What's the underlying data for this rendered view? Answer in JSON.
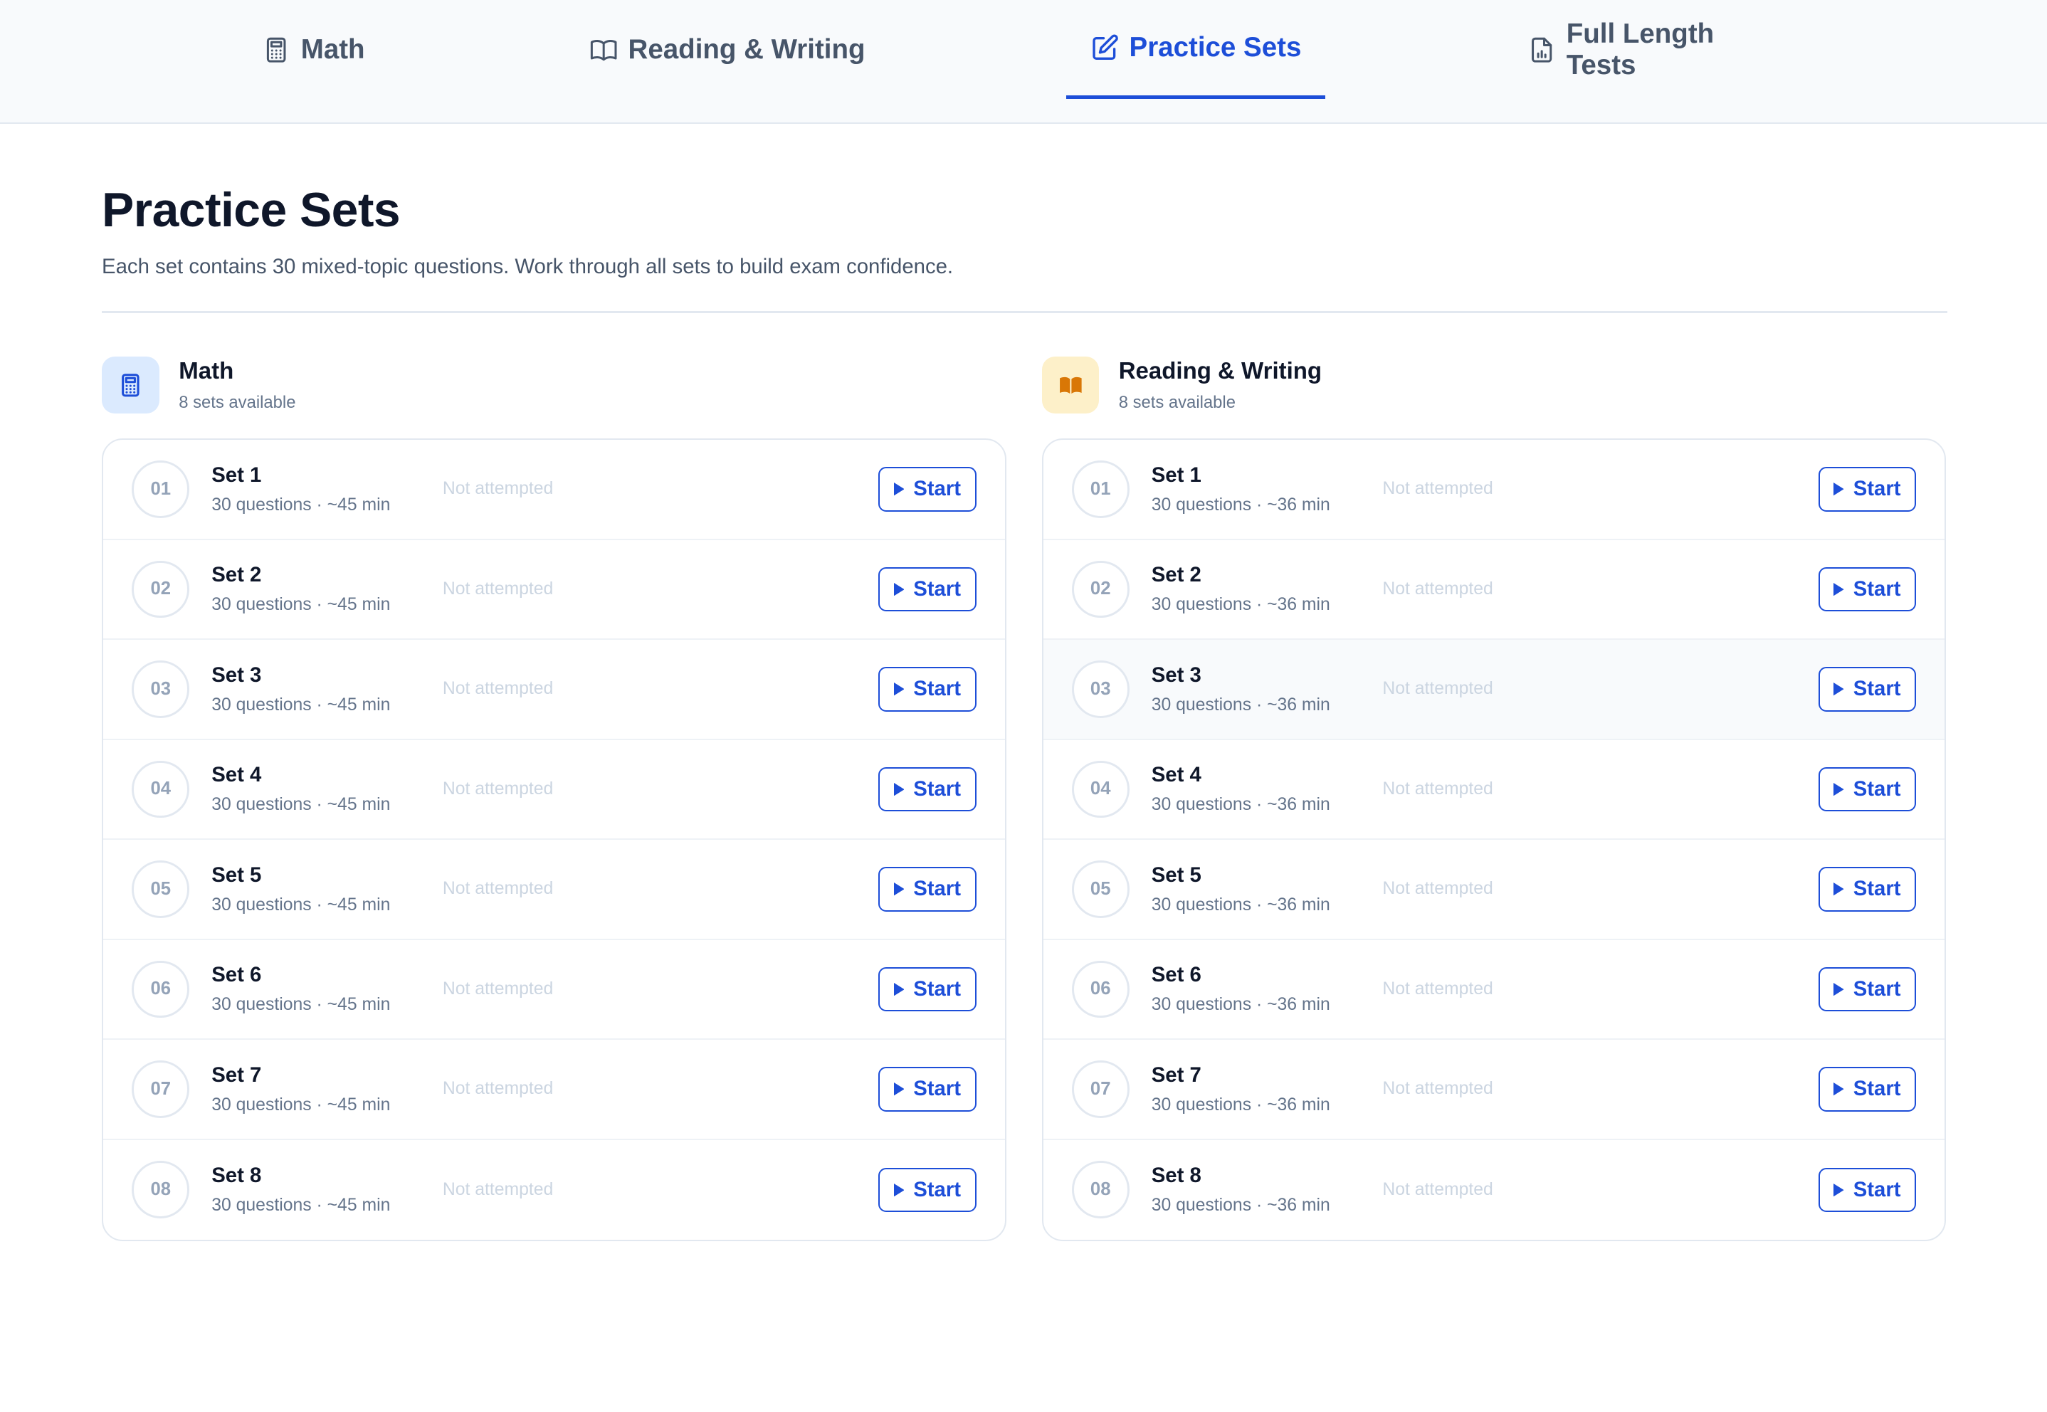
{
  "nav": {
    "tabs": [
      {
        "label": "Math",
        "icon": "calculator-icon"
      },
      {
        "label": "Reading & Writing",
        "icon": "book-open-icon"
      },
      {
        "label": "Practice Sets",
        "icon": "pencil-square-icon",
        "active": true
      },
      {
        "label": "Full Length Tests",
        "icon": "document-chart-icon"
      }
    ]
  },
  "page": {
    "title": "Practice Sets",
    "subtitle": "Each set contains 30 mixed-topic questions. Work through all sets to build exam confidence."
  },
  "colors": {
    "accent": "#1d4ed8",
    "math_icon_bg": "#dbeafe",
    "rw_icon_bg": "#fdf0c9",
    "rw_icon_fg": "#d97706"
  },
  "sections": [
    {
      "title": "Math",
      "count": "8 sets available",
      "icon": "calculator-icon",
      "sets": [
        {
          "num": "01",
          "name": "Set 1",
          "meta": "30 questions · ~45 min",
          "status": "Not attempted",
          "button": "Start"
        },
        {
          "num": "02",
          "name": "Set 2",
          "meta": "30 questions · ~45 min",
          "status": "Not attempted",
          "button": "Start"
        },
        {
          "num": "03",
          "name": "Set 3",
          "meta": "30 questions · ~45 min",
          "status": "Not attempted",
          "button": "Start"
        },
        {
          "num": "04",
          "name": "Set 4",
          "meta": "30 questions · ~45 min",
          "status": "Not attempted",
          "button": "Start"
        },
        {
          "num": "05",
          "name": "Set 5",
          "meta": "30 questions · ~45 min",
          "status": "Not attempted",
          "button": "Start"
        },
        {
          "num": "06",
          "name": "Set 6",
          "meta": "30 questions · ~45 min",
          "status": "Not attempted",
          "button": "Start"
        },
        {
          "num": "07",
          "name": "Set 7",
          "meta": "30 questions · ~45 min",
          "status": "Not attempted",
          "button": "Start"
        },
        {
          "num": "08",
          "name": "Set 8",
          "meta": "30 questions · ~45 min",
          "status": "Not attempted",
          "button": "Start"
        }
      ]
    },
    {
      "title": "Reading & Writing",
      "count": "8 sets available",
      "icon": "book-icon",
      "sets": [
        {
          "num": "01",
          "name": "Set 1",
          "meta": "30 questions · ~36 min",
          "status": "Not attempted",
          "button": "Start"
        },
        {
          "num": "02",
          "name": "Set 2",
          "meta": "30 questions · ~36 min",
          "status": "Not attempted",
          "button": "Start"
        },
        {
          "num": "03",
          "name": "Set 3",
          "meta": "30 questions · ~36 min",
          "status": "Not attempted",
          "button": "Start"
        },
        {
          "num": "04",
          "name": "Set 4",
          "meta": "30 questions · ~36 min",
          "status": "Not attempted",
          "button": "Start"
        },
        {
          "num": "05",
          "name": "Set 5",
          "meta": "30 questions · ~36 min",
          "status": "Not attempted",
          "button": "Start"
        },
        {
          "num": "06",
          "name": "Set 6",
          "meta": "30 questions · ~36 min",
          "status": "Not attempted",
          "button": "Start"
        },
        {
          "num": "07",
          "name": "Set 7",
          "meta": "30 questions · ~36 min",
          "status": "Not attempted",
          "button": "Start"
        },
        {
          "num": "08",
          "name": "Set 8",
          "meta": "30 questions · ~36 min",
          "status": "Not attempted",
          "button": "Start"
        }
      ]
    }
  ]
}
